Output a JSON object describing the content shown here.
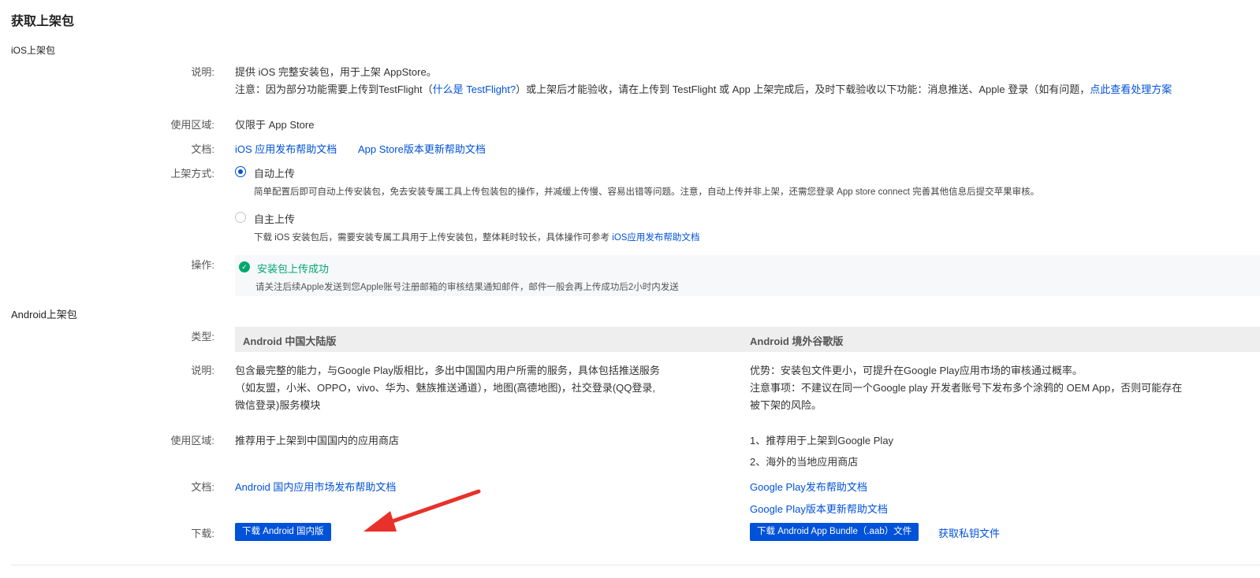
{
  "page_title": "获取上架包",
  "ios": {
    "section_title": "iOS上架包",
    "desc_label": "说明:",
    "desc_line1": "提供 iOS 完整安装包，用于上架 AppStore。",
    "note_prefix": "注意：因为部分功能需要上传到TestFlight（",
    "note_link_testflight": "什么是 TestFlight?",
    "note_middle": "）或上架后才能验收，请在上传到 TestFlight 或 App 上架完成后，及时下载验收以下功能：消息推送、Apple 登录（如有问题，",
    "note_link_solution": "点此查看处理方案",
    "region_label": "使用区域:",
    "region_value": "仅限于 App Store",
    "docs_label": "文档:",
    "doc_links": [
      "iOS 应用发布帮助文档",
      "App Store版本更新帮助文档"
    ],
    "method_label": "上架方式:",
    "methods": [
      {
        "label": "自动上传",
        "checked": true,
        "desc": "简单配置后即可自动上传安装包，免去安装专属工具上传包装包的操作，并减缓上传慢、容易出错等问题。注意，自动上传并非上架，还需您登录 App store connect 完善其他信息后提交苹果审核。"
      },
      {
        "label": "自主上传",
        "checked": false,
        "desc_prefix": "下载 iOS 安装包后，需要安装专属工具用于上传安装包，整体耗时较长，具体操作可参考",
        "desc_link": "iOS应用发布帮助文档"
      }
    ],
    "op_label": "操作:",
    "success_title": "安装包上传成功",
    "success_desc": "请关注后续Apple发送到您Apple账号注册邮箱的审核结果通知邮件，邮件一般会再上传成功后2小时内发送"
  },
  "android": {
    "section_title": "Android上架包",
    "type_label": "类型:",
    "desc_label": "说明:",
    "region_label": "使用区域:",
    "docs_label": "文档:",
    "download_label": "下载:",
    "china": {
      "header": "Android 中国大陆版",
      "desc_lines": [
        "包含最完整的能力，与Google Play版相比，多出中国国内用户所需的服务，具体包括推送服务",
        "（如友盟，小米、OPPO，vivo、华为、魅族推送通道），地图(高德地图)，社交登录(QQ登录,",
        "微信登录)服务模块"
      ],
      "region": "推荐用于上架到中国国内的应用商店",
      "doc_link": "Android 国内应用市场发布帮助文档",
      "download_button": "下载 Android 国内版"
    },
    "google": {
      "header": "Android 境外谷歌版",
      "desc_lines": [
        "优势：安装包文件更小，可提升在Google Play应用市场的审核通过概率。",
        "注意事项：不建议在同一个Google play 开发者账号下发布多个涂鸦的 OEM App，否则可能存在",
        "被下架的风险。"
      ],
      "region_lines": [
        "1、推荐用于上架到Google Play",
        "2、海外的当地应用商店"
      ],
      "doc_links": [
        "Google Play发布帮助文档",
        "Google Play版本更新帮助文档"
      ],
      "download_button": "下载 Android App Bundle（.aab）文件",
      "key_link": "获取私钥文件"
    }
  },
  "colors": {
    "link": "#0052d9",
    "success": "#00a870",
    "arrow": "#e8312a",
    "button": "#0052d9"
  }
}
